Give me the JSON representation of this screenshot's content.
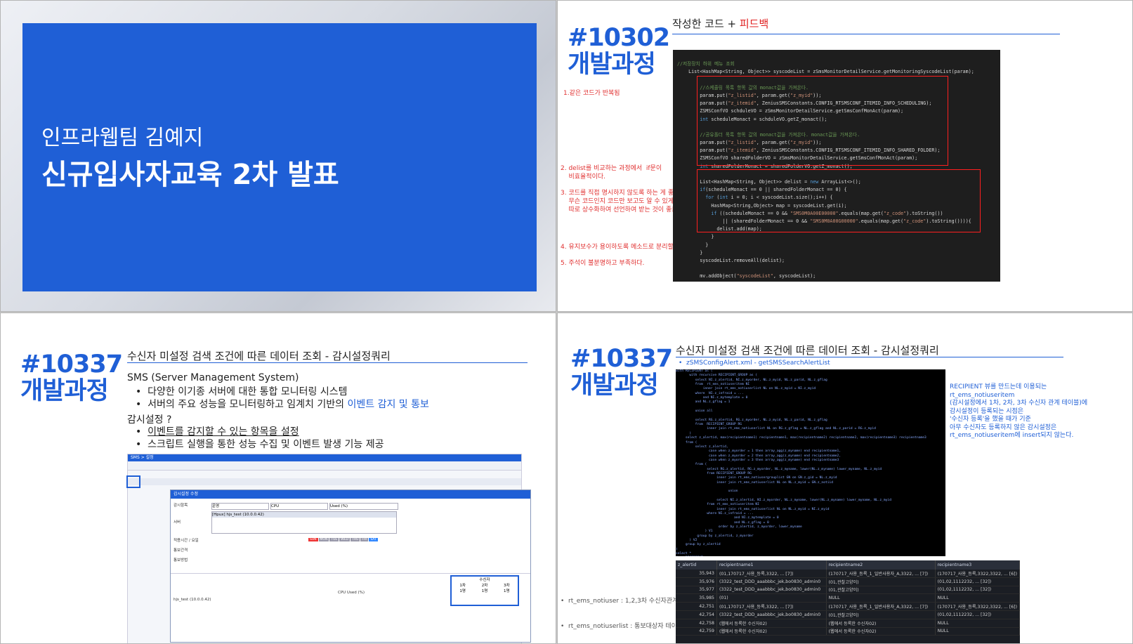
{
  "slide1": {
    "team": "인프라웹팀 김예지",
    "title": "신규입사자교육 2차 발표"
  },
  "slide2": {
    "issue": "#10302",
    "process": "개발과정",
    "header_prefix": "작성한 코드 + ",
    "header_feedback": "피드백",
    "notes": [
      "1.같은 코드가 반복됨",
      "2. delist를 비교하는 과정에서  if문이\n    비효율적이다.",
      "3. 코드를 직접 명시하지 않도록 하는 게 좋다\n    무슨 코드인지 코드만 보고도 알 수 있게\n    따로 상수화하여 선언하여 받는 것이 좋음",
      "4. 유지보수가 용이하도록 메소드로 분리할 것",
      "5. 주석이 불분명하고 부족하다."
    ]
  },
  "slide3": {
    "issue": "#10337",
    "process": "개발과정",
    "header": "수신자 미설정 검색 조건에 따른 데이터 조회 - 감시설정쿼리",
    "line1": "SMS (Server Management System)",
    "bullet1": "다양한 이기종 서버에 대한 통합 모니터링 시스템",
    "bullet2_prefix": "서버의 주요 성능을 모니터링하고 임계치 기반의 ",
    "bullet2_link": "이벤트 감지 및 통보",
    "line2": "감시설정 ?",
    "bullet3": "이벤트를 감지할 수 있는 항목을 설정",
    "bullet4": "스크립트 실행을 통한 성능 수집 및 이벤트 발생 기능 제공",
    "screen": {
      "nav": "SMS > 설정",
      "dialog_title": "감시설정 수정",
      "row_labels": [
        "감시항목",
        "서버",
        "적용시간 / 요일",
        "통보간격",
        "통보방법"
      ],
      "category": "운영",
      "item": "CPU",
      "metric": "Used (%)",
      "server": "[Hpux] hjs_test (10.0.0.42)",
      "days": [
        "SUN",
        "MON",
        "TUE",
        "WED",
        "THU",
        "FRI",
        "SAT"
      ],
      "recv_header": "수신자",
      "recv_cols": [
        "1차",
        "2차",
        "3차"
      ],
      "recv_vals": [
        "1명",
        "1명",
        "1명"
      ],
      "table_server": "hjs_test (10.0.0.42)",
      "table_metric": "CPU Used (%)"
    }
  },
  "slide4": {
    "issue": "#10337",
    "process": "개발과정",
    "header": "수신자 미설정 검색 조건에 따른 데이터 조회 - 감시설정쿼리",
    "link": "zSMSConfigAlert.xml - getSMSSearchAlertList",
    "note": "RECIPIENT 뷰를 만드는데 이용되는\nrt_ems_notiuseritem\n(감시설정에서 1차, 2차, 3차 수신자 관계 테이블)에\n감시설정이 등록되는 시점은\n'수신자 등록'을 했을 때가 기준\n아무 수신자도 등록하지 않은 감시설정은\nrt_ems_notiuseritem에 insert되지 않는다.",
    "footnotes": [
      "rt_ems_notiuser : 1,2,3차 수신자관계테이블",
      "rt_ems_notiuserlist : 통보대상자 테이블"
    ],
    "grid": {
      "columns": [
        "z_alertid",
        "recipientname1",
        "recipientname2",
        "recipientname3"
      ],
      "rows": [
        [
          "35,943",
          "(01,170717_사용_등록,3322, ... [7])",
          "(170717_사용_등록_1_일반사용자_A,3322, ... [7])",
          "(170717_사용_등록,3322,3322, ... [6])"
        ],
        [
          "35,976",
          "(3322_test_DDD_aaabbbc_jek,bo0830_admin0",
          "(01,관찰고양이)",
          "(01,02,1112232, ... [32])"
        ],
        [
          "35,977",
          "(3322_test_DDD_aaabbbc_jek,bo0830_admin0",
          "(01,관찰고양이)",
          "(01,02,1112232, ... [32])"
        ],
        [
          "35,985",
          "(01)",
          "NULL",
          "NULL"
        ],
        [
          "42,751",
          "(01,170717_사용_등록,3322, ... [7])",
          "(170717_사용_등록_1_일반사용자_A,3322, ... [7])",
          "(170717_사용_등록,3322,3322, ... [6])"
        ],
        [
          "42,754",
          "(3322_test_DDD_aaabbbc_jek,bo0830_admin0",
          "(01,관찰고양이)",
          "(01,02,1112232, ... [32])"
        ],
        [
          "42,758",
          "(웹에서 등록한 수신자02)",
          "(웹에서 등록한 수신자02)",
          "NULL"
        ],
        [
          "42,759",
          "(웹에서 등록한 수신자02)",
          "(웹에서 등록한 수신자02)",
          "NULL"
        ]
      ]
    }
  },
  "colors": {
    "brand_blue": "#1f5fd6",
    "feedback_red": "#e02020",
    "code_bg": "#1e1e1e"
  }
}
